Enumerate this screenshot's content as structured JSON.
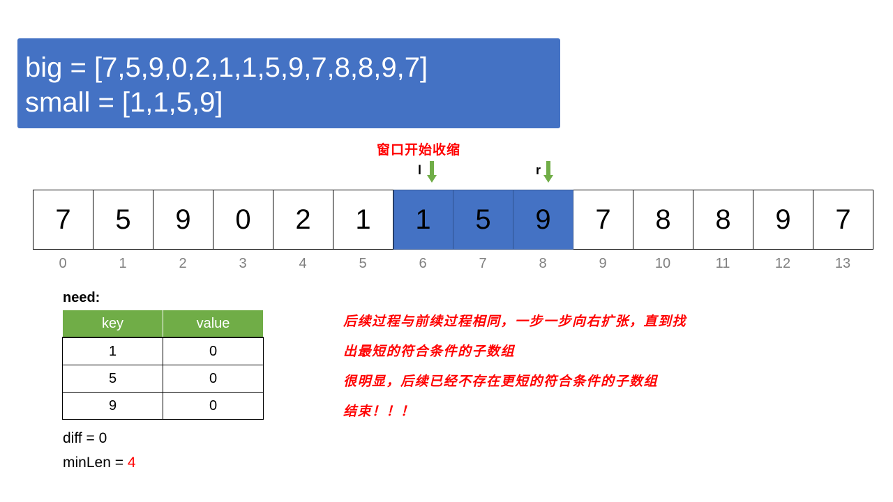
{
  "header": {
    "big_line": "big = [7,5,9,0,2,1,1,5,9,7,8,8,9,7]",
    "small_line": "small = [1,1,5,9]"
  },
  "annotation": {
    "shrink_note": "窗口开始收缩",
    "left_pointer": "l",
    "right_pointer": "r"
  },
  "array": {
    "cells": [
      "7",
      "5",
      "9",
      "0",
      "2",
      "1",
      "1",
      "5",
      "9",
      "7",
      "8",
      "8",
      "9",
      "7"
    ],
    "indices": [
      "0",
      "1",
      "2",
      "3",
      "4",
      "5",
      "6",
      "7",
      "8",
      "9",
      "10",
      "11",
      "12",
      "13"
    ],
    "highlighted_range": [
      6,
      8
    ],
    "left_pointer_index": 6,
    "right_pointer_index": 8
  },
  "need": {
    "label": "need:",
    "headers": [
      "key",
      "value"
    ],
    "rows": [
      [
        "1",
        "0"
      ],
      [
        "5",
        "0"
      ],
      [
        "9",
        "0"
      ]
    ]
  },
  "stats": {
    "diff_text": "diff = 0",
    "minlen_prefix": "minLen = ",
    "minlen_value": "4"
  },
  "conclusion": {
    "lines": [
      "后续过程与前续过程相同，一步一步向右扩张，直到找",
      "出最短的符合条件的子数组",
      "很明显，后续已经不存在更短的符合条件的子数组",
      "结束！！！"
    ]
  },
  "colors": {
    "highlight": "#4472c4",
    "table_header": "#70ad47",
    "arrow": "#70ad47",
    "note": "#ff0000",
    "index_text": "#808080"
  }
}
